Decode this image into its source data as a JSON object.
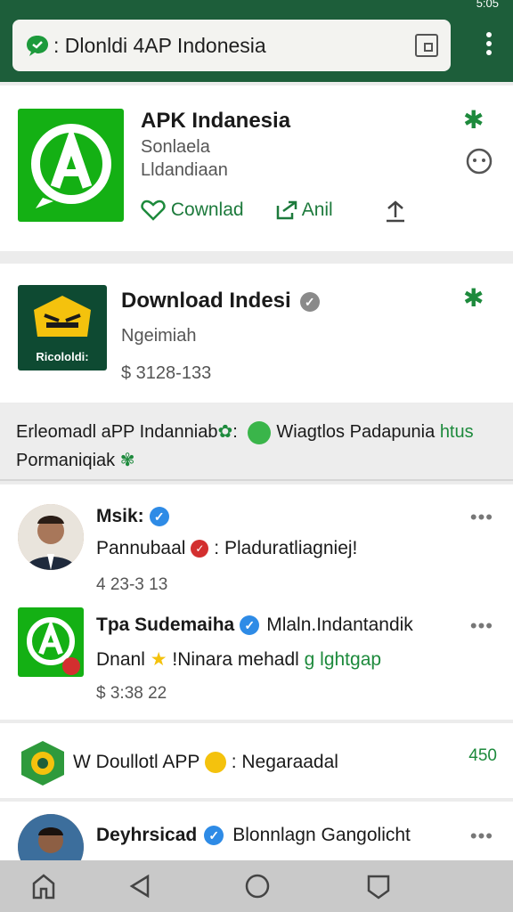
{
  "status": {
    "text": "5:05"
  },
  "browser": {
    "url": ": Dlonldi 4AP Indonesia"
  },
  "app_card": {
    "title": "APK Indanesia",
    "sub1": "Sonlaela",
    "sub2": "Lldandiaan",
    "download_label": "Cownlad",
    "share_label": "Anil"
  },
  "featured": {
    "title": "Download Indesi",
    "logo_text": "Ricololdi:",
    "sub": "Ngeimiah",
    "price": "$ 3128-133"
  },
  "banner": {
    "line1_a": "Erleomadl aPP Indanniab",
    "line1_b": ": ",
    "line1_c": "Wiagtlos Padapunia",
    "line1_d": "htus",
    "line2": "Pormaniqiak"
  },
  "posts": [
    {
      "name": "Msik:",
      "text_a": "Pannubaal",
      "text_b": ": Pladuratliagniej!",
      "time": "4 23-3 13",
      "more": "•••"
    },
    {
      "name": "Tpa Sudemaiha",
      "name_extra": "Mlaln.Indantandik",
      "text_a": "Dnanl",
      "text_b": "!Ninara mehadl",
      "text_c": "g lghtgap",
      "time": "$ 3:38 22",
      "more": "•••"
    }
  ],
  "promo": {
    "text_a": "W Doullotl APP",
    "text_b": ": Negaraadal",
    "count": "450"
  },
  "last_post": {
    "name": "Deyhrsicad",
    "text": "Blonnlagn Gangolicht",
    "more": "•••"
  },
  "colors": {
    "toolbar": "#1d5e3a",
    "accent": "#1d8a3c",
    "logo_green": "#14b014"
  }
}
